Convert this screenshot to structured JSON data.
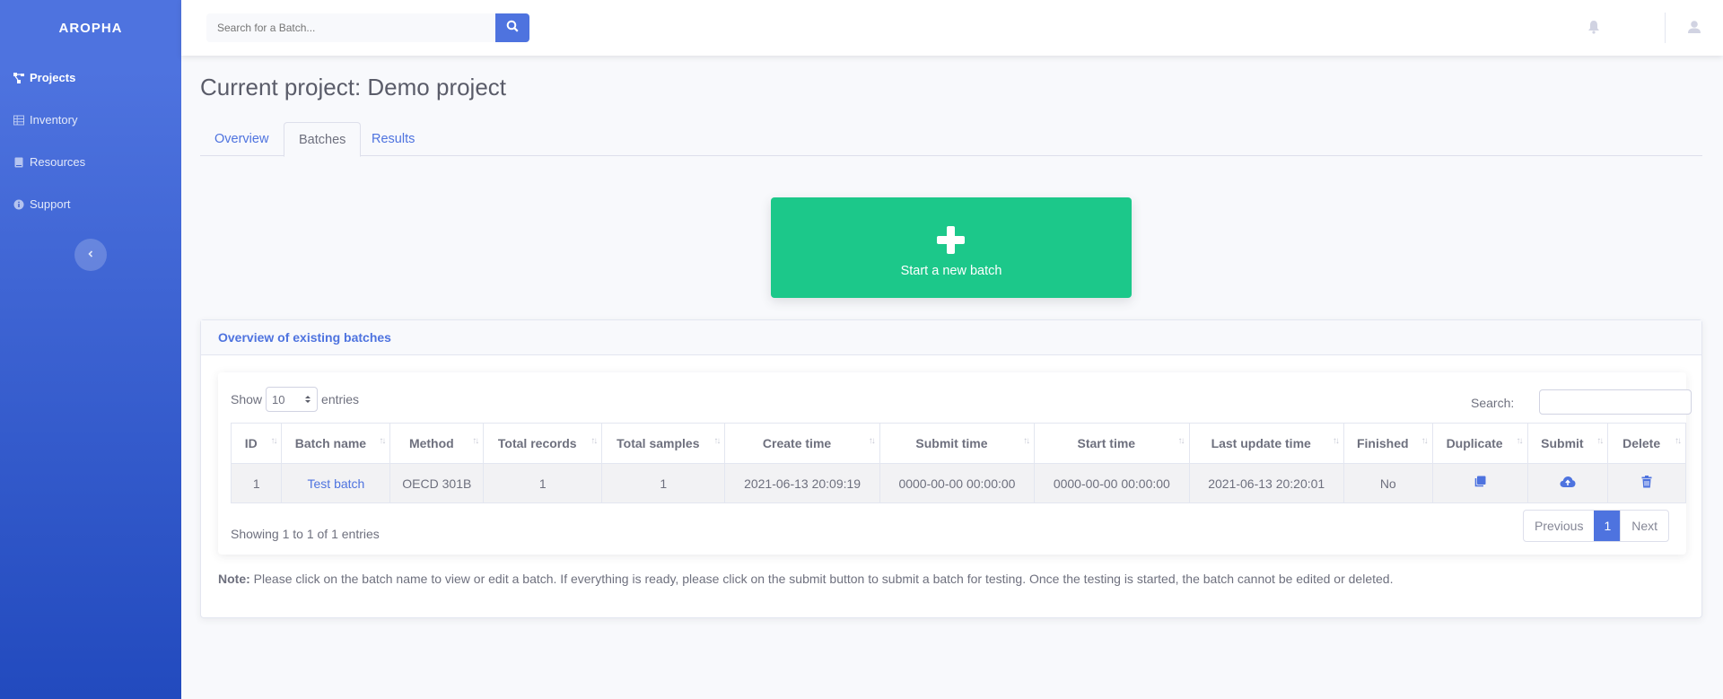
{
  "brand": "AROPHA",
  "sidebar": {
    "items": [
      {
        "label": "Projects",
        "icon": "project-diagram-icon",
        "active": true
      },
      {
        "label": "Inventory",
        "icon": "table-icon"
      },
      {
        "label": "Resources",
        "icon": "book-icon"
      },
      {
        "label": "Support",
        "icon": "info-circle-icon"
      }
    ],
    "toggle_icon": "chevron-left-icon"
  },
  "topbar": {
    "search_placeholder": "Search for a Batch...",
    "search_icon": "search-icon",
    "bell_icon": "bell-icon",
    "user_icon": "user-icon"
  },
  "page": {
    "title": "Current project: Demo project",
    "tabs": [
      {
        "label": "Overview"
      },
      {
        "label": "Batches",
        "active": true
      },
      {
        "label": "Results"
      }
    ]
  },
  "start_button": {
    "label": "Start a new batch",
    "icon": "plus-icon"
  },
  "card": {
    "header": "Overview of existing batches",
    "show_label": "Show",
    "entries_value": "10",
    "entries_label": "entries",
    "search_label": "Search:",
    "columns": [
      "ID",
      "Batch name",
      "Method",
      "Total records",
      "Total samples",
      "Create time",
      "Submit time",
      "Start time",
      "Last update time",
      "Finished",
      "Duplicate",
      "Submit",
      "Delete"
    ],
    "rows": [
      {
        "id": "1",
        "name": "Test batch",
        "method": "OECD 301B",
        "total_records": "1",
        "total_samples": "1",
        "create_time": "2021-06-13 20:09:19",
        "submit_time": "0000-00-00 00:00:00",
        "start_time": "0000-00-00 00:00:00",
        "last_update": "2021-06-13 20:20:01",
        "finished": "No"
      }
    ],
    "showing": "Showing 1 to 1 of 1 entries",
    "pagination": {
      "previous": "Previous",
      "page": "1",
      "next": "Next"
    },
    "note_label": "Note:",
    "note_text": " Please click on the batch name to view or edit a batch. If everything is ready, please click on the submit button to submit a batch for testing. Once the testing is started, the batch cannot be edited or deleted."
  },
  "colors": {
    "primary": "#4e73df",
    "success": "#1cc88a",
    "sidebar_dark": "#224abe"
  }
}
